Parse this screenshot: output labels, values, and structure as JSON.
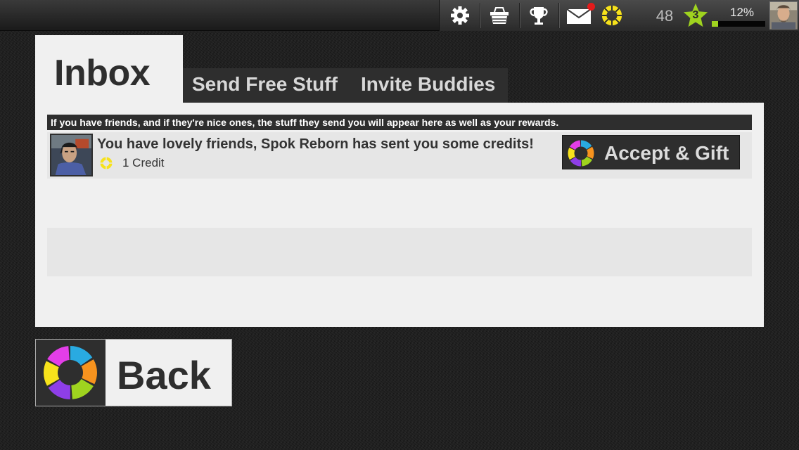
{
  "topbar": {
    "icons": [
      "gear-icon",
      "basket-icon",
      "trophy-icon",
      "mail-icon",
      "credit-ring-icon"
    ],
    "credits": "48",
    "level": "3",
    "xp_percent_label": "12%",
    "xp_fraction": 0.12,
    "colors": {
      "star": "#9fd31f",
      "xp_fill": "#9fd31f",
      "notification": "#e31b1b",
      "credit": "#f7e21b"
    }
  },
  "tabs": {
    "inbox": "Inbox",
    "send_free_stuff": "Send Free Stuff",
    "invite_buddies": "Invite Buddies"
  },
  "inbox": {
    "info": "If you have friends, and if they're nice ones, the stuff they send you will appear here as well as your rewards.",
    "messages": [
      {
        "text": "You have lovely friends, Spok Reborn has sent you some credits!",
        "reward": "1 Credit",
        "action": "Accept & Gift"
      }
    ]
  },
  "back": {
    "label": "Back"
  },
  "colors": {
    "panel": "#f0f0f0",
    "dark": "#2e2e2e",
    "ring": [
      "#29aae1",
      "#f7931e",
      "#9fd31f",
      "#8e3ee8",
      "#f7e21b",
      "#e33ee8"
    ]
  }
}
